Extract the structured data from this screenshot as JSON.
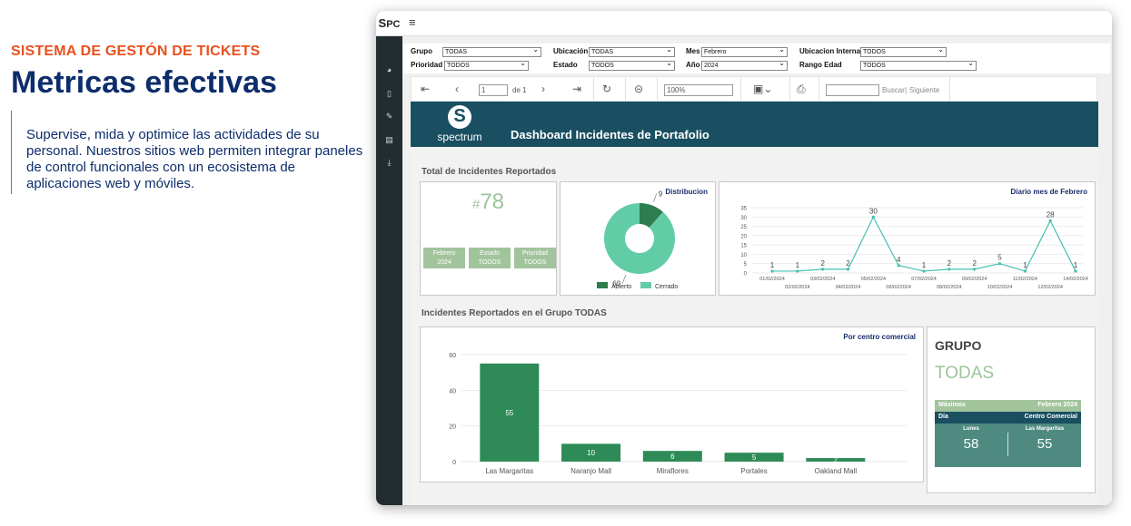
{
  "hero": {
    "kicker": "SISTEMA DE GESTÓN DE TICKETS",
    "title": "Metricas efectivas",
    "description": "Supervise, mida y optimice las actividades de su personal. Nuestros sitios web permiten integrar paneles de control funcionales con un ecosistema de aplicaciones web y móviles."
  },
  "app": {
    "logo_bold": "S",
    "logo_rest": "PC",
    "menu_icon": "hamburger-icon"
  },
  "params": {
    "grupo": {
      "label": "Grupo",
      "value": "TODAS"
    },
    "prioridad": {
      "label": "Prioridad",
      "value": "TODOS"
    },
    "ubicacion": {
      "label": "Ubicación",
      "value": "TODAS"
    },
    "estado": {
      "label": "Estado",
      "value": "TODOS"
    },
    "mes": {
      "label": "Mes",
      "value": "Febrero"
    },
    "anio": {
      "label": "Año",
      "value": "2024"
    },
    "ubic_interna": {
      "label": "Ubicacion Interna",
      "value": "TODOS"
    },
    "rango_edad": {
      "label": "Rango Edad",
      "value": "TODOS"
    }
  },
  "toolbar": {
    "page": "1",
    "of_label": "de 1",
    "zoom": "100%",
    "find_label": "Buscar",
    "sep": "|",
    "next_label": "Siguiente"
  },
  "dashboard": {
    "brand": "spectrum",
    "title": "Dashboard Incidentes de Portafolio",
    "section1": "Total de Incidentes Reportados",
    "total_prefix": "#",
    "total": "78",
    "tags": [
      {
        "line1": "Febrero",
        "line2": "2024"
      },
      {
        "line1": "Estado",
        "line2": "TODOS"
      },
      {
        "line1": "Prioridad",
        "line2": "TODOS"
      }
    ],
    "distrib_title": "Distribucion",
    "daily_title": "Diario mes de Febrero",
    "section2": "Incidentes Reportados en el Grupo TODAS",
    "bar_title": "Por centro comercial",
    "group_heading": "GRUPO",
    "group_value": "TODAS",
    "maximos": {
      "label": "Máximos",
      "period": "Febrero 2024",
      "dia_label": "Día",
      "centro_label": "Centro Comercial",
      "dia_name": "Lunes",
      "dia_value": "58",
      "centro_name": "Las Margaritas",
      "centro_value": "55"
    }
  },
  "chart_data": [
    {
      "type": "pie",
      "title": "Distribucion",
      "categories": [
        "Abierto",
        "Cerrado"
      ],
      "values": [
        9,
        69
      ],
      "colors": [
        "#2e7d4f",
        "#62cca6"
      ],
      "legend": "bottom"
    },
    {
      "type": "line",
      "title": "Diario mes de Febrero",
      "x": [
        "01/02/2024",
        "02/02/2024",
        "03/02/2024",
        "04/02/2024",
        "05/02/2024",
        "06/02/2024",
        "07/02/2024",
        "08/02/2024",
        "09/02/2024",
        "10/02/2024",
        "11/02/2024",
        "12/02/2024",
        "14/02/2024"
      ],
      "values": [
        1,
        1,
        2,
        2,
        30,
        4,
        1,
        2,
        2,
        5,
        1,
        28,
        1
      ],
      "yticks": [
        0,
        5,
        10,
        15,
        20,
        25,
        30,
        35
      ],
      "ylim": [
        0,
        35
      ],
      "grid": true,
      "color": "#45c0b0"
    },
    {
      "type": "bar",
      "title": "Por centro comercial",
      "categories": [
        "Las Margaritas",
        "Naranjo Mall",
        "Miraflores",
        "Portales",
        "Oakland Mall"
      ],
      "values": [
        55,
        10,
        6,
        5,
        2
      ],
      "yticks": [
        0,
        20,
        40,
        60
      ],
      "ylim": [
        0,
        60
      ],
      "grid": true,
      "color": "#2e8b57"
    }
  ]
}
